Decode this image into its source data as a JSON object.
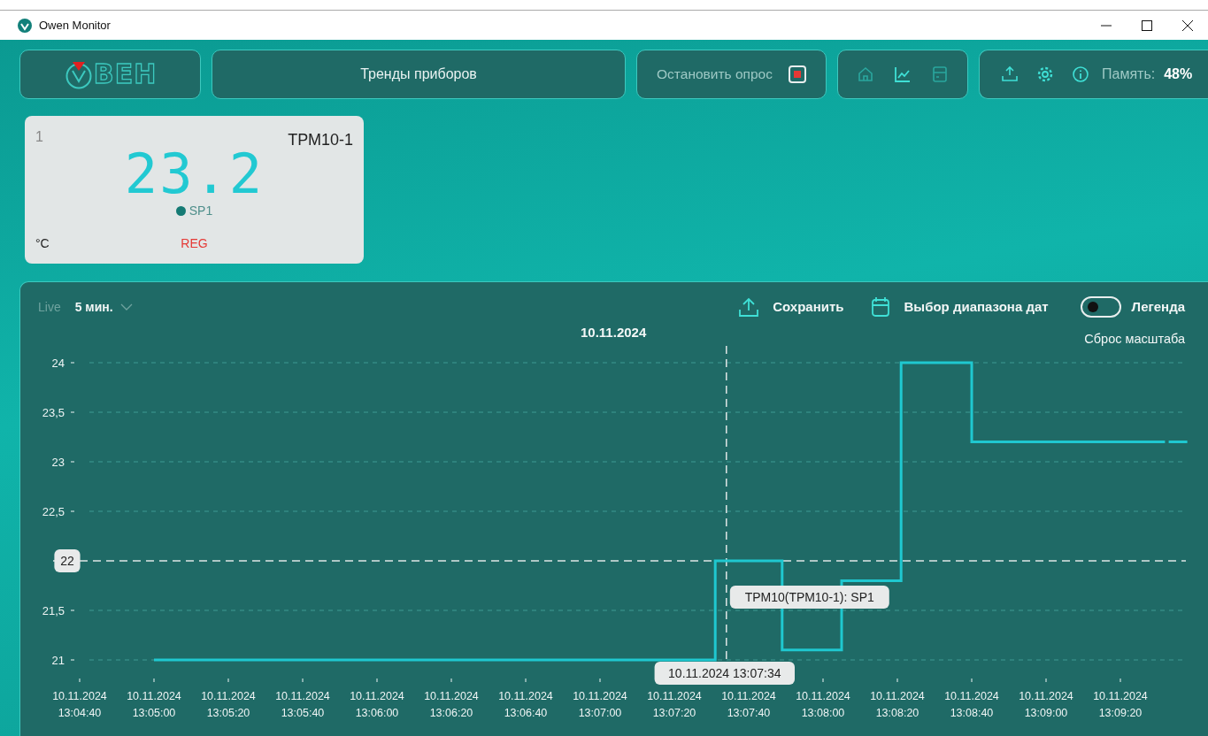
{
  "window": {
    "title": "Owen Monitor"
  },
  "toolbar": {
    "logo": "ВЕН",
    "title": "Тренды приборов",
    "stop_button": {
      "label": "Остановить опрос",
      "on": true
    },
    "nav": [
      {
        "kind": "home",
        "selected": false
      },
      {
        "kind": "chart",
        "selected": true
      },
      {
        "kind": "device",
        "selected": false
      }
    ],
    "memory_label": "Память:",
    "memory_value": "48%"
  },
  "device_card": {
    "number": "1",
    "name": "ТРМ10-1",
    "value": "23.2",
    "channel": "SP1",
    "unit": "°C",
    "mode": "REG"
  },
  "chart_panel": {
    "live": "Live",
    "period": "5 мин.",
    "save": "Сохранить",
    "date_range": "Выбор диапазона дат",
    "legend": {
      "label": "Легенда",
      "on": false
    },
    "reset": "Сброс масштаба",
    "chart_data": {
      "type": "line",
      "title": "10.11.2024",
      "x": [
        "2024-11-10T13:05:00",
        "2024-11-10T13:07:31",
        "2024-11-10T13:07:31",
        "2024-11-10T13:07:49",
        "2024-11-10T13:07:49",
        "2024-11-10T13:08:05",
        "2024-11-10T13:08:05",
        "2024-11-10T13:08:21",
        "2024-11-10T13:08:21",
        "2024-11-10T13:08:40",
        "2024-11-10T13:08:40",
        "2024-11-10T13:09:32",
        "2024-11-10T13:09:32.5",
        "2024-11-10T13:09:33",
        "2024-11-10T13:09:38"
      ],
      "series": [
        {
          "name": "ТРМ10(ТРМ10-1): SP1",
          "color": "#1fc8d0",
          "values": [
            21,
            21,
            22,
            22,
            21.1,
            21.1,
            21.8,
            21.8,
            24,
            24,
            23.2,
            23.2,
            null,
            23.2,
            23.2
          ]
        }
      ],
      "xlim": [
        "2024-11-10T13:04:40",
        "2024-11-10T13:09:38"
      ],
      "ylim": [
        21,
        24
      ],
      "grid": true,
      "xticks": [
        {
          "value": "2024-11-10T13:04:40",
          "label": "10.11.2024 13:04:40"
        },
        {
          "value": "2024-11-10T13:05:00",
          "label": "10.11.2024 13:05:00"
        },
        {
          "value": "2024-11-10T13:05:20",
          "label": "10.11.2024 13:05:20"
        },
        {
          "value": "2024-11-10T13:05:40",
          "label": "10.11.2024 13:05:40"
        },
        {
          "value": "2024-11-10T13:06:00",
          "label": "10.11.2024 13:06:00"
        },
        {
          "value": "2024-11-10T13:06:20",
          "label": "10.11.2024 13:06:20"
        },
        {
          "value": "2024-11-10T13:06:40",
          "label": "10.11.2024 13:06:40"
        },
        {
          "value": "2024-11-10T13:07:00",
          "label": "10.11.2024 13:07:00"
        },
        {
          "value": "2024-11-10T13:07:20",
          "label": "10.11.2024 13:07:20"
        },
        {
          "value": "2024-11-10T13:07:40",
          "label": "10.11.2024 13:07:40"
        },
        {
          "value": "2024-11-10T13:08:00",
          "label": "10.11.2024 13:08:00"
        },
        {
          "value": "2024-11-10T13:08:20",
          "label": "10.11.2024 13:08:20"
        },
        {
          "value": "2024-11-10T13:08:40",
          "label": "10.11.2024 13:08:40"
        },
        {
          "value": "2024-11-10T13:09:00",
          "label": "10.11.2024 13:09:00"
        },
        {
          "value": "2024-11-10T13:09:20",
          "label": "10.11.2024 13:09:20"
        }
      ],
      "yticks": [
        {
          "value": 21,
          "label": "21"
        },
        {
          "value": 21.5,
          "label": "21,5"
        },
        {
          "value": 22.5,
          "label": "22,5"
        },
        {
          "value": 23,
          "label": "23"
        },
        {
          "value": 23.5,
          "label": "23,5"
        },
        {
          "value": 24,
          "label": "24"
        }
      ],
      "ref_lines": [
        {
          "axis": "y",
          "value": 22,
          "label": "22"
        },
        {
          "axis": "x",
          "value": "2024-11-10T13:07:34",
          "label": "10.11.2024 13:07:34"
        }
      ]
    }
  }
}
